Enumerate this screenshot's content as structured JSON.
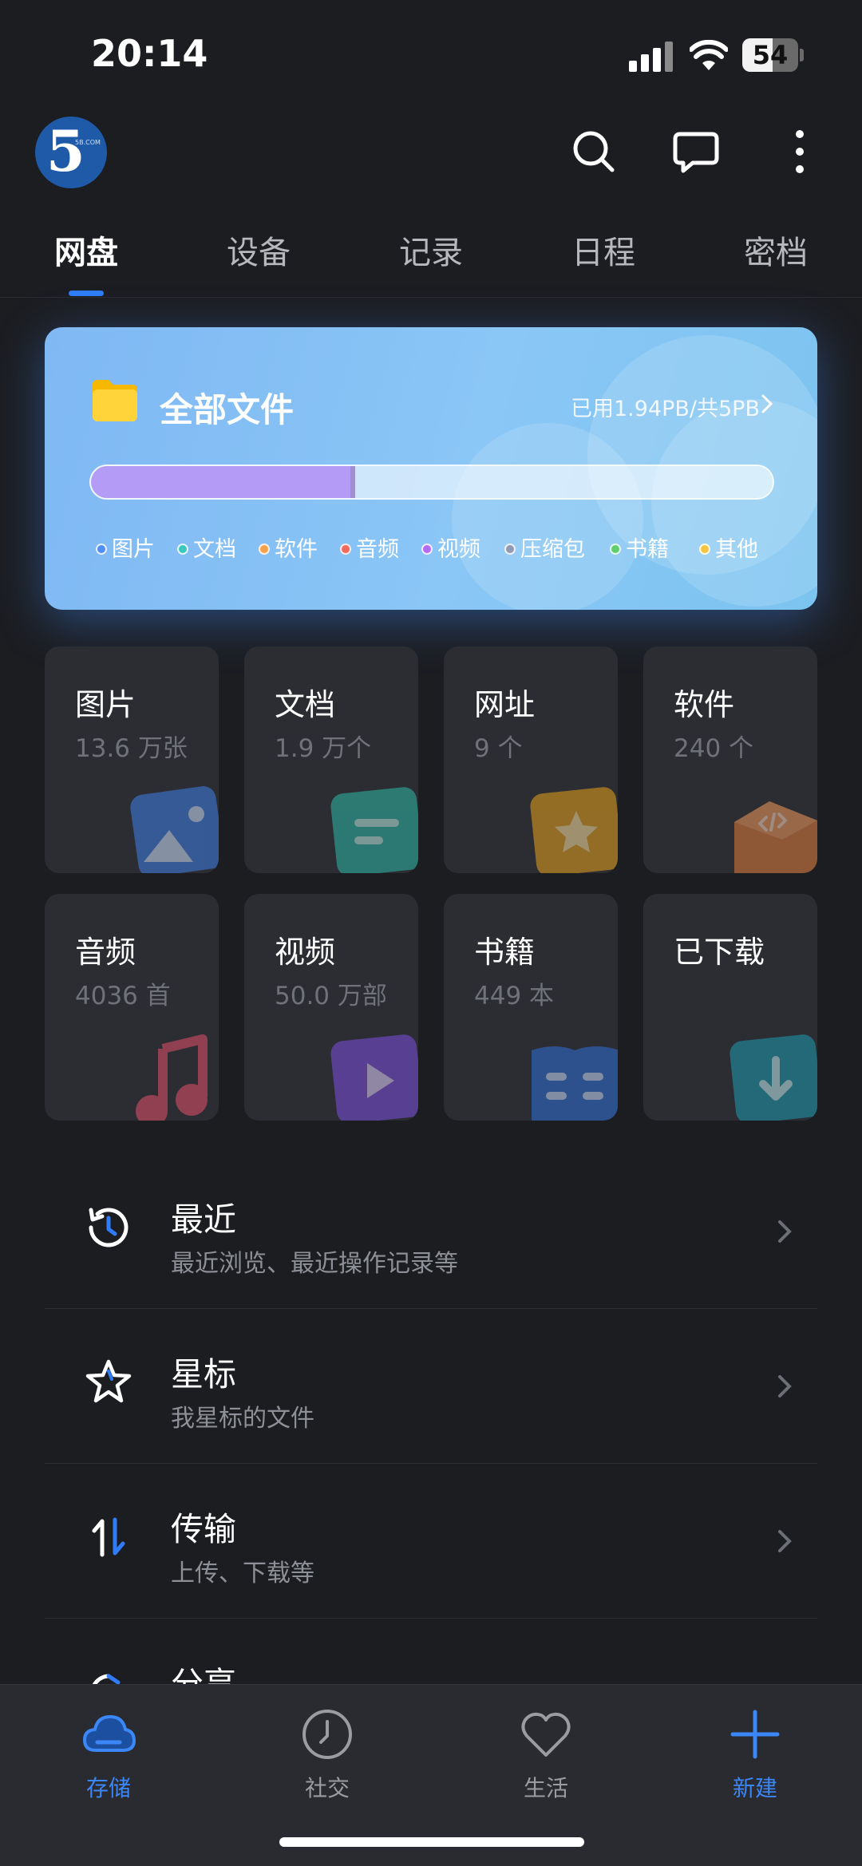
{
  "status_bar": {
    "time": "20:14",
    "battery_level": "54",
    "battery_fraction": 0.54
  },
  "header": {
    "logo_text": "5",
    "logo_small_text": "5B.COM",
    "icons": [
      "search-icon",
      "message-icon",
      "more-vertical-icon"
    ]
  },
  "tabs": [
    {
      "label": "网盘",
      "active": true
    },
    {
      "label": "设备",
      "active": false
    },
    {
      "label": "记录",
      "active": false
    },
    {
      "label": "日程",
      "active": false
    },
    {
      "label": "密档",
      "active": false
    }
  ],
  "storage": {
    "title": "全部文件",
    "usage_text": "已用1.94PB/共5PB",
    "used_fraction": 0.388,
    "legend": [
      {
        "label": "图片",
        "color": "#4f8ef5"
      },
      {
        "label": "文档",
        "color": "#3ec6c0"
      },
      {
        "label": "软件",
        "color": "#f5a24a"
      },
      {
        "label": "音频",
        "color": "#f26a5a"
      },
      {
        "label": "视频",
        "color": "#b26cf5"
      },
      {
        "label": "压缩包",
        "color": "#8f9ab2"
      },
      {
        "label": "书籍",
        "color": "#5fcf6f"
      },
      {
        "label": "其他",
        "color": "#f5c542"
      }
    ]
  },
  "categories": [
    {
      "name": "图片",
      "count": "13.6 万张",
      "icon": "image-icon"
    },
    {
      "name": "文档",
      "count": "1.9 万个",
      "icon": "document-icon"
    },
    {
      "name": "网址",
      "count": "9 个",
      "icon": "star-icon"
    },
    {
      "name": "软件",
      "count": "240 个",
      "icon": "software-box-icon"
    },
    {
      "name": "音频",
      "count": "4036 首",
      "icon": "music-note-icon"
    },
    {
      "name": "视频",
      "count": "50.0 万部",
      "icon": "play-icon"
    },
    {
      "name": "书籍",
      "count": "449 本",
      "icon": "book-icon"
    },
    {
      "name": "已下载",
      "count": "",
      "icon": "download-icon"
    }
  ],
  "list": [
    {
      "title": "最近",
      "subtitle": "最近浏览、最近操作记录等",
      "icon": "history-icon"
    },
    {
      "title": "星标",
      "subtitle": "我星标的文件",
      "icon": "star-outline-icon"
    },
    {
      "title": "传输",
      "subtitle": "上传、下载等",
      "icon": "transfer-icon"
    },
    {
      "title": "分享",
      "subtitle": "",
      "icon": "share-icon"
    }
  ],
  "bottom_nav": [
    {
      "label": "存储",
      "icon": "cloud-icon",
      "active": true
    },
    {
      "label": "社交",
      "icon": "clock-icon",
      "active": false
    },
    {
      "label": "生活",
      "icon": "heart-icon",
      "active": false
    },
    {
      "label": "新建",
      "icon": "plus-icon",
      "active": true
    }
  ],
  "colors": {
    "background": "#1c1d21",
    "accent": "#2f7cf6",
    "tile": "#2c2d33",
    "card_gradient_start": "#7fb8f3",
    "card_gradient_end": "#7cc4f0",
    "progress_fill": "#b49cf6"
  }
}
